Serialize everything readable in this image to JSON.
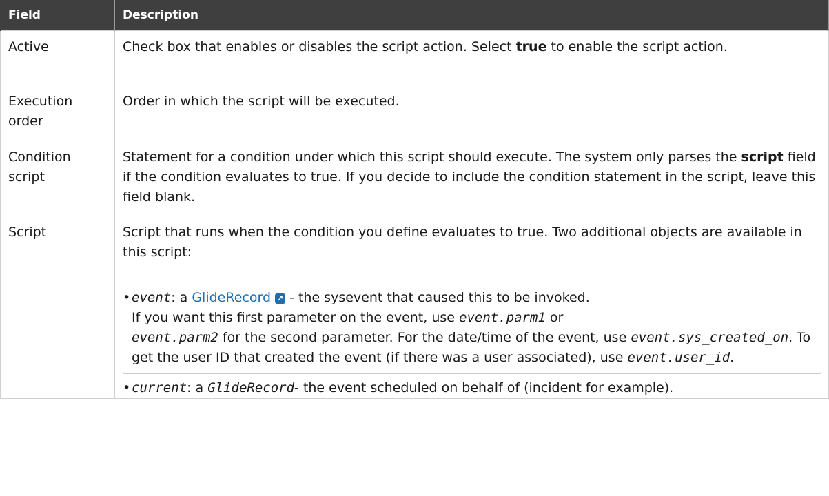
{
  "table": {
    "headers": [
      "Field",
      "Description"
    ],
    "rows": [
      {
        "field": "Active",
        "desc_a": "Check box that enables or disables the script action. Select ",
        "desc_bold": "true",
        "desc_b": " to enable the script action."
      },
      {
        "field_1": "Execution",
        "field_2": "order",
        "desc": "Order in which the script will be executed."
      },
      {
        "field_1": "Condition",
        "field_2": "script",
        "desc_a": "Statement for a condition under which this script should execute. The system only parses the ",
        "desc_bold": "script",
        "desc_b": " field if the condition evaluates to true. If you decide to include the condition statement in the script, leave this field blank."
      },
      {
        "field": "Script",
        "desc_intro": "Script that runs when the condition you define evaluates to true. Two additional objects are available in this script:",
        "bullets": {
          "event": {
            "code": "event",
            "t1": ": a ",
            "link": "GlideRecord",
            "t2": " - the sysevent that caused this to be invoked.",
            "t3": "If you want this first parameter on the event, use ",
            "code2": "event.parm1",
            "t4": " or",
            "code3": "event.parm2",
            "t5": " for the second parameter. For the date/time of the event, use ",
            "code4": "event.sys_created_on",
            "t6": ". To get the user ID that created the event (if there was a user associated), use ",
            "code5": "event.user_id",
            "t7": "."
          },
          "current": {
            "code": "current",
            "t1": ": a ",
            "code2": "GlideRecord",
            "t2": "- the event scheduled on behalf of (incident for example)."
          }
        }
      }
    ]
  },
  "icons": {
    "external_link": "external-link-icon"
  },
  "colors": {
    "header_bg": "#3f3f3f",
    "link": "#1f6fb0",
    "border": "#cfcfcf"
  }
}
